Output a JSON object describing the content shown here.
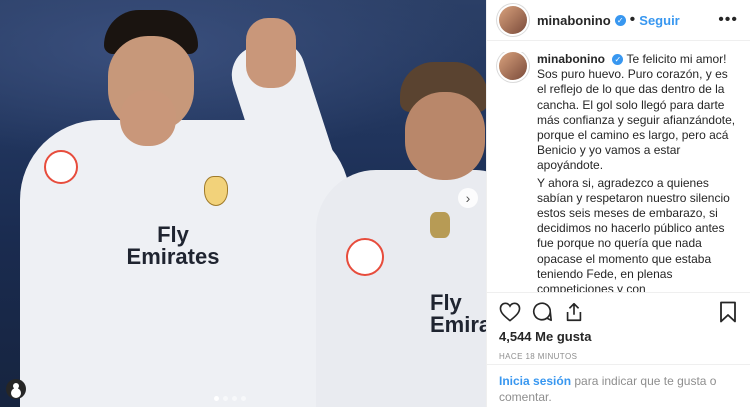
{
  "post": {
    "username": "minabonino",
    "follow_label": "Seguir",
    "separator": "•",
    "more_label": "•••",
    "photo": {
      "sponsor_1": "Fly\nEmirates",
      "sponsor_2": "Fly\nEmirat",
      "league_badge": "LaLiga",
      "carousel_dots": 4,
      "active_dot": 0,
      "next_arrow": "›"
    },
    "caption": {
      "author": "minabonino",
      "lines": [
        "Te felicito mi amor! Sos puro huevo. Puro corazón, y es el reflejo de lo que das dentro de la cancha. El gol solo llegó para darte más confianza y seguir afianzándote, porque el camino es largo, pero acá Benicio y yo vamos a estar apoyándote.",
        "Y ahora si, agradezco a quienes sabían y respetaron nuestro silencio estos seis meses de embarazo, si decidimos no hacerlo público antes fue porque no quería que nada opacase el momento que estaba teniendo Fede, en plenas competiciones y con"
      ]
    },
    "likes": "4,544 Me gusta",
    "timestamp": "HACE 18 MINUTOS",
    "login": {
      "link": "Inicia sesión",
      "text": " para indicar que te gusta o comentar."
    },
    "icons": [
      "heart-icon",
      "comment-icon",
      "share-icon",
      "bookmark-icon"
    ],
    "colors": {
      "link": "#3897f0",
      "text": "#262626",
      "muted": "#8e8e8e",
      "border": "#efefef"
    }
  }
}
